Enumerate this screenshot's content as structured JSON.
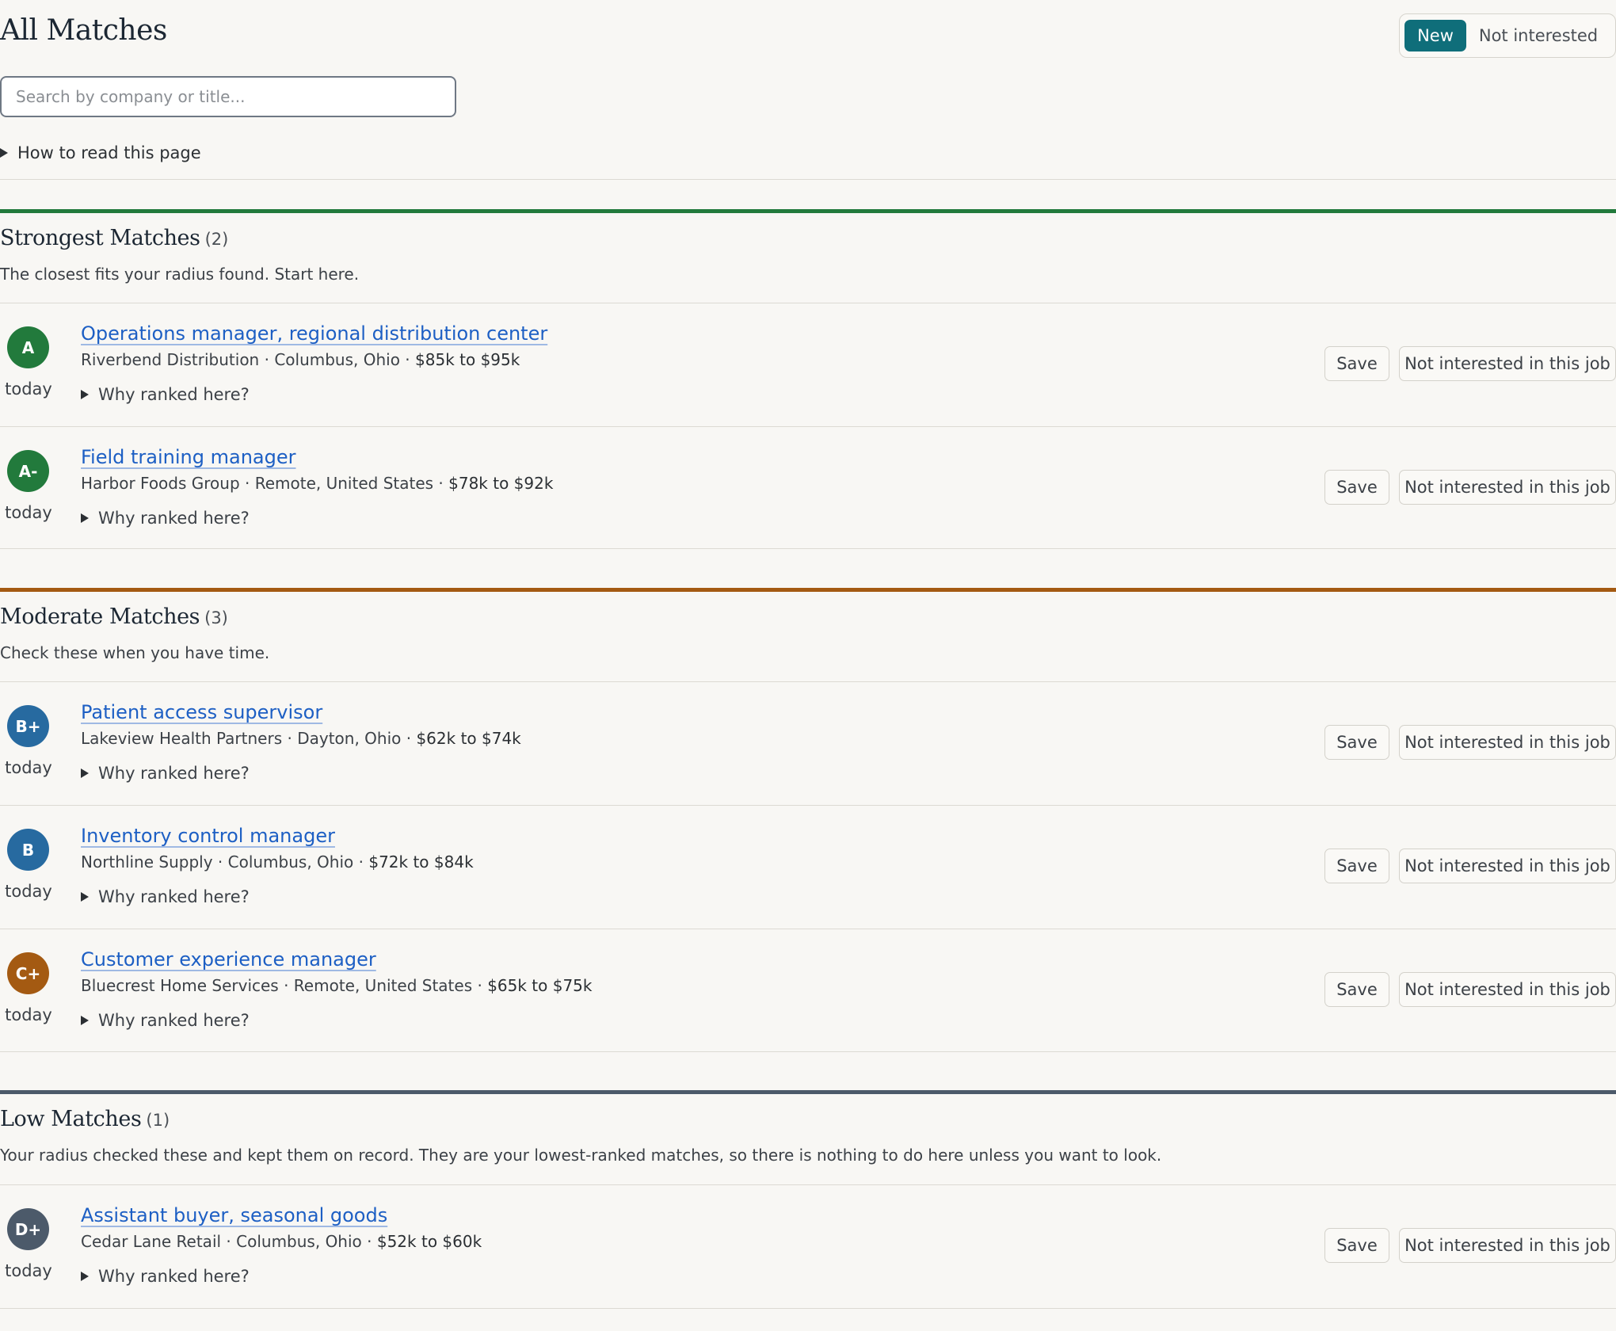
{
  "header": {
    "title": "All Matches",
    "toggle": {
      "active": "New",
      "inactive": "Not interested"
    },
    "search_placeholder": "Search by company or title...",
    "howto": "How to read this page"
  },
  "colors": {
    "accent": "#0f6e7a",
    "link": "#1d5fc4",
    "strong": "#227a3c",
    "moderate": "#a45a12",
    "low": "#4c5a6a",
    "grade_b": "#276aa0"
  },
  "labels": {
    "save": "Save",
    "not_interested": "Not interested in this job",
    "why": "Why ranked here?",
    "sep": " · "
  },
  "sections": [
    {
      "title": "Strongest Matches",
      "count": "(2)",
      "subtitle": "The closest fits your radius found. Start here.",
      "jobs": [
        {
          "grade": "A",
          "grade_color": "#227a3c",
          "title": "Operations manager, regional distribution center",
          "company": "Riverbend Distribution",
          "location": "Columbus, Ohio",
          "salary": "$85k to $95k",
          "posted": "today"
        },
        {
          "grade": "A-",
          "grade_color": "#227a3c",
          "title": "Field training manager",
          "company": "Harbor Foods Group",
          "location": "Remote, United States",
          "salary": "$78k to $92k",
          "posted": "today"
        }
      ]
    },
    {
      "title": "Moderate Matches",
      "count": "(3)",
      "subtitle": "Check these when you have time.",
      "jobs": [
        {
          "grade": "B+",
          "grade_color": "#276aa0",
          "title": "Patient access supervisor",
          "company": "Lakeview Health Partners",
          "location": "Dayton, Ohio",
          "salary": "$62k to $74k",
          "posted": "today"
        },
        {
          "grade": "B",
          "grade_color": "#276aa0",
          "title": "Inventory control manager",
          "company": "Northline Supply",
          "location": "Columbus, Ohio",
          "salary": "$72k to $84k",
          "posted": "today"
        },
        {
          "grade": "C+",
          "grade_color": "#a45a12",
          "title": "Customer experience manager",
          "company": "Bluecrest Home Services",
          "location": "Remote, United States",
          "salary": "$65k to $75k",
          "posted": "today"
        }
      ]
    },
    {
      "title": "Low Matches",
      "count": "(1)",
      "subtitle": "Your radius checked these and kept them on record. They are your lowest-ranked matches, so there is nothing to do here unless you want to look.",
      "jobs": [
        {
          "grade": "D+",
          "grade_color": "#4c5a6a",
          "title": "Assistant buyer, seasonal goods",
          "company": "Cedar Lane Retail",
          "location": "Columbus, Ohio",
          "salary": "$52k to $60k",
          "posted": "today"
        }
      ]
    }
  ]
}
